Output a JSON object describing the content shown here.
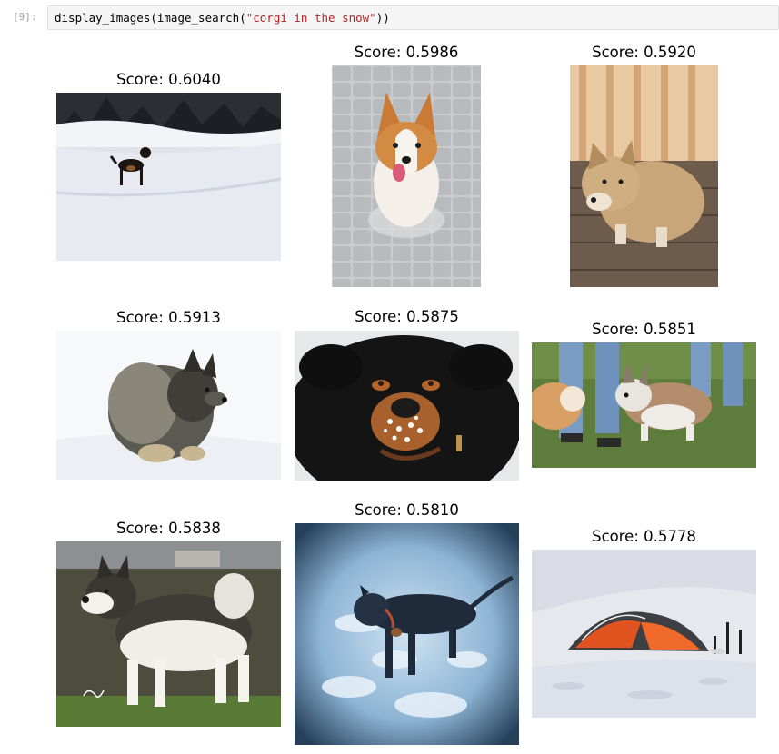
{
  "cell": {
    "prompt": "[9]:",
    "code_prefix": "display_images(image_search(",
    "code_string": "\"corgi in the snow\"",
    "code_suffix": "))"
  },
  "results": [
    {
      "score": "Score: 0.6040",
      "image": "black-dog-on-snow-image"
    },
    {
      "score": "Score: 0.5986",
      "image": "corgi-on-pavement-image"
    },
    {
      "score": "Score: 0.5920",
      "image": "shiba-on-deck-image"
    },
    {
      "score": "Score: 0.5913",
      "image": "keeshond-in-snow-image"
    },
    {
      "score": "Score: 0.5875",
      "image": "rottweiler-snowy-face-image"
    },
    {
      "score": "Score: 0.5851",
      "image": "two-corgis-on-grass-image"
    },
    {
      "score": "Score: 0.5838",
      "image": "malamute-on-grass-image"
    },
    {
      "score": "Score: 0.5810",
      "image": "dog-in-snow-vignette-image"
    },
    {
      "score": "Score: 0.5778",
      "image": "orange-tent-in-snow-image"
    }
  ]
}
